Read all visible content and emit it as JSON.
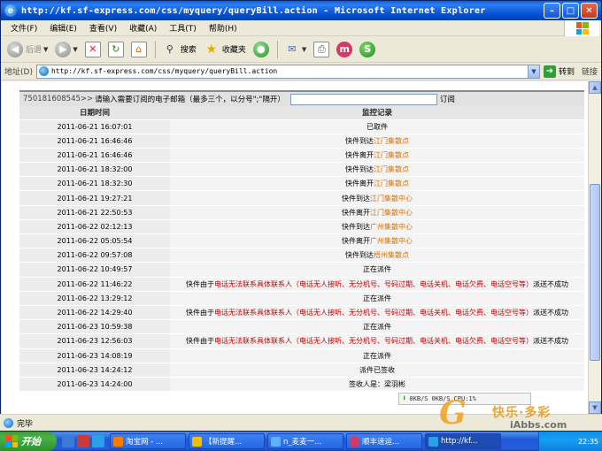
{
  "window": {
    "title": "http://kf.sf-express.com/css/myquery/queryBill.action - Microsoft Internet Explorer"
  },
  "menu": [
    "文件(F)",
    "编辑(E)",
    "查看(V)",
    "收藏(A)",
    "工具(T)",
    "帮助(H)"
  ],
  "toolbar": {
    "back": "后退",
    "search": "搜索",
    "favorites": "收藏夹"
  },
  "address": {
    "label": "地址(D)",
    "url": "http://kf.sf-express.com/css/myquery/queryBill.action",
    "go": "转到",
    "links": "链接"
  },
  "query": {
    "number": "750181608545>>",
    "hint": "请输入需要订阅的电子邮箱（最多三个，以分号\";\"隔开）",
    "subscribe": "订阅"
  },
  "table": {
    "headers": [
      "日期时间",
      "监控记录"
    ],
    "rows": [
      {
        "date": "2011-06-21 16:07:01",
        "pre": "已取件",
        "loc": "",
        "post": ""
      },
      {
        "date": "2011-06-21 16:46:46",
        "pre": "快件到达",
        "loc": "江门集散点",
        "post": ""
      },
      {
        "date": "2011-06-21 16:46:46",
        "pre": "快件离开",
        "loc": "江门集散点",
        "post": ""
      },
      {
        "date": "2011-06-21 18:32:00",
        "pre": "快件到达",
        "loc": "江门集散点",
        "post": ""
      },
      {
        "date": "2011-06-21 18:32:30",
        "pre": "快件离开",
        "loc": "江门集散点",
        "post": ""
      },
      {
        "date": "2011-06-21 19:27:21",
        "pre": "快件到达",
        "loc": "江门集散中心",
        "post": ""
      },
      {
        "date": "2011-06-21 22:50:53",
        "pre": "快件离开",
        "loc": "江门集散中心",
        "post": ""
      },
      {
        "date": "2011-06-22 02:12:13",
        "pre": "快件到达",
        "loc": "广州集散中心",
        "post": ""
      },
      {
        "date": "2011-06-22 05:05:54",
        "pre": "快件离开",
        "loc": "广州集散中心",
        "post": ""
      },
      {
        "date": "2011-06-22 09:57:08",
        "pre": "快件到达",
        "loc": "梧州集散点",
        "post": ""
      },
      {
        "date": "2011-06-22 10:49:57",
        "pre": "正在派件",
        "loc": "",
        "post": ""
      },
      {
        "date": "2011-06-22 11:46:22",
        "pre": "快件由于",
        "reason": "电话无法联系具体联系人（电话无人接听、无分机号、号码过期、电话关机、电话欠费、电话空号等）",
        "post": "派送不成功"
      },
      {
        "date": "2011-06-22 13:29:12",
        "pre": "正在派件",
        "loc": "",
        "post": ""
      },
      {
        "date": "2011-06-22 14:29:40",
        "pre": "快件由于",
        "reason": "电话无法联系具体联系人（电话无人接听、无分机号、号码过期、电话关机、电话欠费、电话空号等）",
        "post": "派送不成功"
      },
      {
        "date": "2011-06-23 10:59:38",
        "pre": "正在派件",
        "loc": "",
        "post": ""
      },
      {
        "date": "2011-06-23 12:56:03",
        "pre": "快件由于",
        "reason": "电话无法联系具体联系人（电话无人接听、无分机号、号码过期、电话关机、电话欠费、电话空号等）",
        "post": "派送不成功"
      },
      {
        "date": "2011-06-23 14:08:19",
        "pre": "正在派件",
        "loc": "",
        "post": ""
      },
      {
        "date": "2011-06-23 14:24:12",
        "pre": "派件已签收",
        "loc": "",
        "post": ""
      },
      {
        "date": "2011-06-23 14:24:00",
        "pre": "签收人是：梁羽彬",
        "loc": "",
        "post": ""
      }
    ]
  },
  "statusbar": {
    "text": "完毕"
  },
  "netmeter": {
    "down": "0KB/S",
    "up": "0KB/S",
    "cpu": "CPU:1%"
  },
  "watermark": {
    "letter": "G",
    "cn": "快乐·多彩",
    "url": "iAbbs.com"
  },
  "taskbar": {
    "start": "开始",
    "tasks": [
      "淘宝网 - ...",
      "【新提醒...",
      "n_麦麦一...",
      "顺丰速运...",
      "http://kf..."
    ],
    "clock": "22:35"
  },
  "colors": {
    "location": "#d87000",
    "reason": "#c00000",
    "title_bar": "#0450d0",
    "taskbar": "#245edb"
  }
}
